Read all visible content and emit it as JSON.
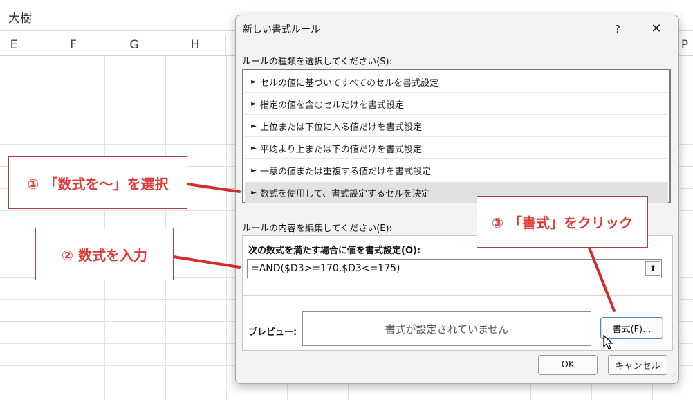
{
  "sheet": {
    "cell_value": "大樹",
    "columns": [
      "E",
      "F",
      "G",
      "H",
      "P"
    ]
  },
  "dialog": {
    "title": "新しい書式ルール",
    "help_label": "?",
    "close_label": "✕",
    "rule_type_label": "ルールの種類を選択してください(S):",
    "rule_types": [
      "セルの値に基づいてすべてのセルを書式設定",
      "指定の値を含むセルだけを書式設定",
      "上位または下位に入る値だけを書式設定",
      "平均より上または下の値だけを書式設定",
      "一意の値または重複する値だけを書式設定",
      "数式を使用して、書式設定するセルを決定"
    ],
    "selected_rule_index": 5,
    "edit_label": "ルールの内容を編集してください(E):",
    "formula_caption": "次の数式を満たす場合に値を書式設定(O):",
    "formula_value": "=AND($D3>=170,$D3<=175)",
    "preview_label": "プレビュー:",
    "preview_text": "書式が設定されていません",
    "format_button": "書式(F)...",
    "ok_button": "OK",
    "cancel_button": "キャンセル"
  },
  "annotations": {
    "step1": "① 「数式を～」を選択",
    "step2": "② 数式を入力",
    "step3": "③ 「書式」をクリック",
    "color": "#e03a3a"
  },
  "icons": {
    "rule_arrow": "►",
    "collapse": "⬆",
    "resize_grip": "⋰"
  }
}
